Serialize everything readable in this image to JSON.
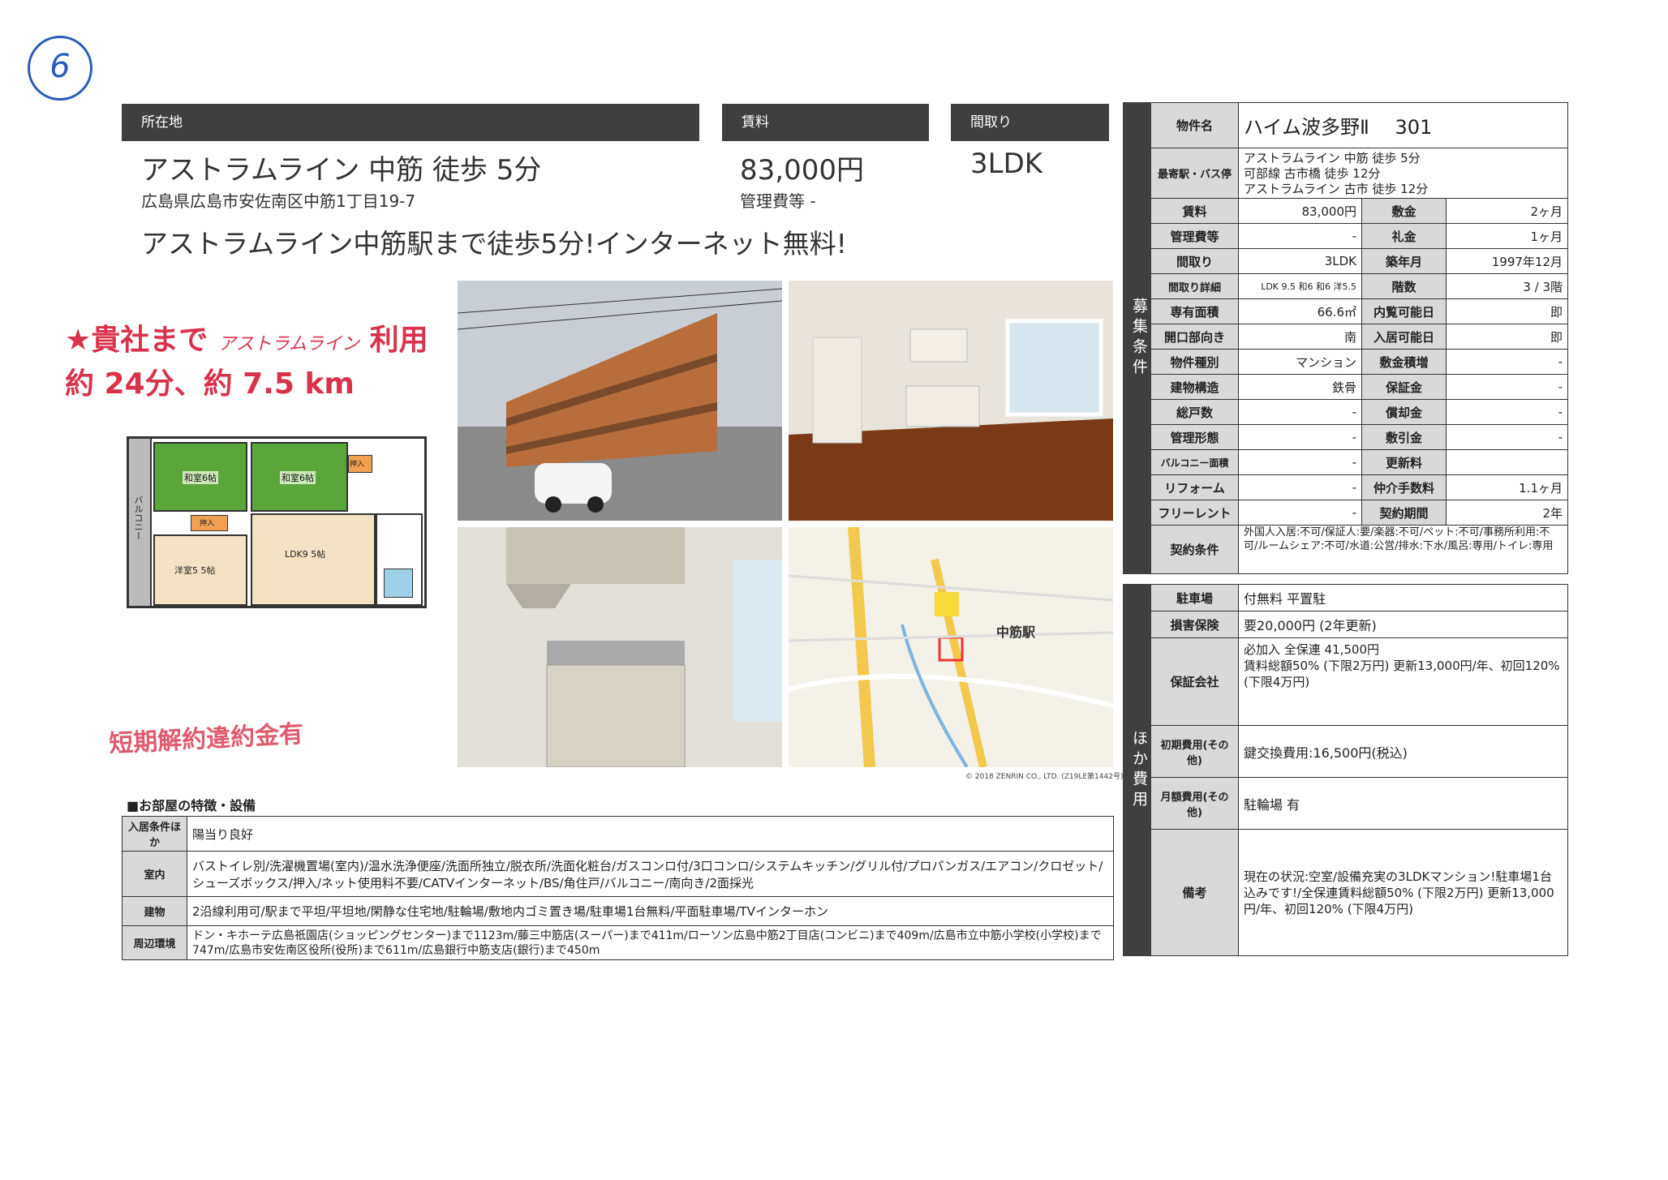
{
  "handwritten_number": "6",
  "headers": {
    "location": "所在地",
    "rent": "賃料",
    "layout": "間取り"
  },
  "summary": {
    "access": "アストラムライン 中筋 徒歩 5分",
    "address": "広島県広島市安佐南区中筋1丁目19-7",
    "rent": "83,000円",
    "mgmt_fee": "管理費等 -",
    "layout": "3LDK",
    "catchphrase": "アストラムライン中筋駅まで徒歩5分!インターネット無料!"
  },
  "handwritten_notes": {
    "line1_a": "★貴社まで",
    "line1_b": "アストラムライン",
    "line1_c": "利用",
    "line2": "約 24分、約 7.5 km",
    "short_term": "短期解約違約金有"
  },
  "floorplan": {
    "rooms": [
      "和室6帖",
      "和室6帖",
      "洋室5 5帖",
      "LDK9 5帖",
      "押入",
      "押入",
      "バルコニー"
    ]
  },
  "map": {
    "station_label": "中筋駅",
    "copyright": "© 2018 ZENRIN CO., LTD. (Z19LE第1442号)"
  },
  "property": {
    "name_label": "物件名",
    "name": "ハイム波多野Ⅱ　 301",
    "station_label": "最寄駅・バス停",
    "stations": [
      "アストラムライン 中筋 徒歩 5分",
      "可部線 古市橋 徒歩 12分",
      "アストラムライン 古市 徒歩 12分"
    ],
    "rows": [
      {
        "l1": "賃料",
        "v1": "83,000円",
        "l2": "敷金",
        "v2": "2ヶ月"
      },
      {
        "l1": "管理費等",
        "v1": "-",
        "l2": "礼金",
        "v2": "1ヶ月"
      },
      {
        "l1": "間取り",
        "v1": "3LDK",
        "l2": "築年月",
        "v2": "1997年12月"
      },
      {
        "l1": "間取り詳細",
        "v1": "LDK 9.5 和6 和6 洋5.5",
        "l2": "階数",
        "v2": "3 / 3階"
      },
      {
        "l1": "専有面積",
        "v1": "66.6㎡",
        "l2": "内覧可能日",
        "v2": "即"
      },
      {
        "l1": "開口部向き",
        "v1": "南",
        "l2": "入居可能日",
        "v2": "即"
      },
      {
        "l1": "物件種別",
        "v1": "マンション",
        "l2": "敷金積増",
        "v2": "-"
      },
      {
        "l1": "建物構造",
        "v1": "鉄骨",
        "l2": "保証金",
        "v2": "-"
      },
      {
        "l1": "総戸数",
        "v1": "-",
        "l2": "償却金",
        "v2": "-"
      },
      {
        "l1": "管理形態",
        "v1": "-",
        "l2": "敷引金",
        "v2": "-"
      },
      {
        "l1": "バルコニー面積",
        "v1": "-",
        "l2": "更新料",
        "v2": ""
      },
      {
        "l1": "リフォーム",
        "v1": "-",
        "l2": "仲介手数料",
        "v2": "1.1ヶ月"
      },
      {
        "l1": "フリーレント",
        "v1": "-",
        "l2": "契約期間",
        "v2": "2年"
      }
    ],
    "contract_label": "契約条件",
    "contract": "外国人入居:不可/保証人:要/楽器:不可/ペット:不可/事務所利用:不可/ルームシェア:不可/水道:公営/排水:下水/風呂:専用/トイレ:専用",
    "side_label": "募集条件"
  },
  "costs": {
    "side_label": "ほか費用",
    "rows": [
      {
        "label": "駐車場",
        "value": "付無料 平置駐"
      },
      {
        "label": "損害保険",
        "value": "要20,000円 (2年更新)"
      },
      {
        "label": "保証会社",
        "value": "必加入 全保連 41,500円\n賃料総額50% (下限2万円) 更新13,000円/年、初回120% (下限4万円)"
      },
      {
        "label": "初期費用(その他)",
        "value": "鍵交換費用:16,500円(税込)"
      },
      {
        "label": "月額費用(その他)",
        "value": "駐輪場 有"
      },
      {
        "label": "備考",
        "value": "現在の状況:空室/設備充実の3LDKマンション!駐車場1台込みです!/全保連賃料総額50% (下限2万円) 更新13,000円/年、初回120% (下限4万円)"
      }
    ]
  },
  "features": {
    "title": "■お部屋の特徴・設備",
    "rows": [
      {
        "label": "入居条件ほか",
        "value": "陽当り良好"
      },
      {
        "label": "室内",
        "value": "バストイレ別/洗濯機置場(室内)/温水洗浄便座/洗面所独立/脱衣所/洗面化粧台/ガスコンロ付/3口コンロ/システムキッチン/グリル付/プロパンガス/エアコン/クロゼット/シューズボックス/押入/ネット使用料不要/CATVインターネット/BS/角住戸/バルコニー/南向き/2面採光"
      },
      {
        "label": "建物",
        "value": "2沿線利用可/駅まで平坦/平坦地/閑静な住宅地/駐輪場/敷地内ゴミ置き場/駐車場1台無料/平面駐車場/TVインターホン"
      },
      {
        "label": "周辺環境",
        "value": "ドン・キホーテ広島祇園店(ショッピングセンター)まで1123m/藤三中筋店(スーパー)まで411m/ローソン広島中筋2丁目店(コンビニ)まで409m/広島市立中筋小学校(小学校)まで747m/広島市安佐南区役所(役所)まで611m/広島銀行中筋支店(銀行)まで450m"
      }
    ]
  }
}
